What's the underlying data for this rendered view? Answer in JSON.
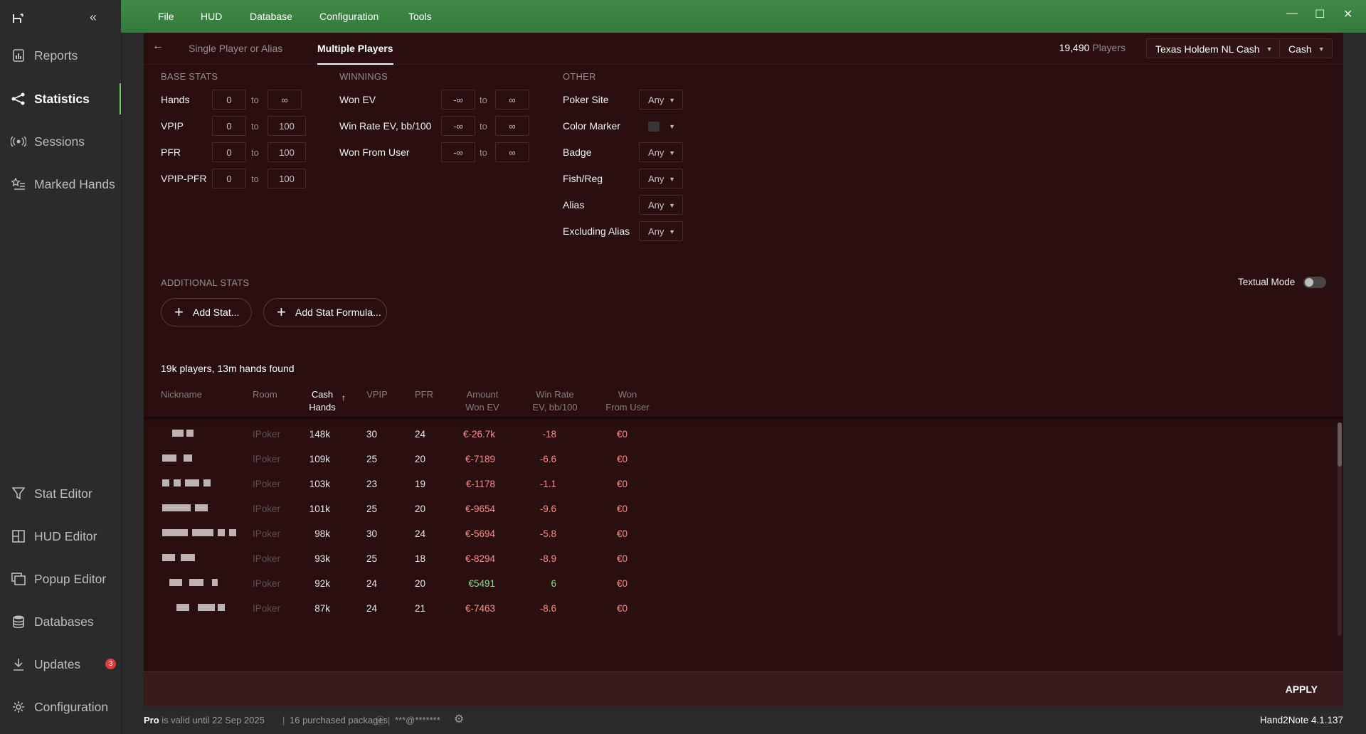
{
  "sidebar": {
    "items": [
      {
        "label": "Reports",
        "icon": "report-icon"
      },
      {
        "label": "Statistics",
        "icon": "share-graph-icon",
        "active": true
      },
      {
        "label": "Sessions",
        "icon": "broadcast-icon"
      },
      {
        "label": "Marked Hands",
        "icon": "starred-list-icon"
      },
      {
        "label": "Stat Editor",
        "icon": "filter-icon"
      },
      {
        "label": "HUD Editor",
        "icon": "hud-grid-icon"
      },
      {
        "label": "Popup Editor",
        "icon": "popup-icon"
      },
      {
        "label": "Databases",
        "icon": "database-icon"
      },
      {
        "label": "Updates",
        "icon": "download-icon",
        "badge": "3"
      },
      {
        "label": "Configuration",
        "icon": "gear-icon"
      }
    ]
  },
  "menu": [
    "File",
    "HUD",
    "Database",
    "Configuration",
    "Tools"
  ],
  "tabs": {
    "single": "Single Player or Alias",
    "multiple": "Multiple Players"
  },
  "header": {
    "players_count": "19,490",
    "players_label": "Players",
    "game": "Texas Holdem NL Cash",
    "mode": "Cash"
  },
  "base_stats": {
    "title": "BASE STATS",
    "rows": [
      {
        "label": "Hands",
        "from": "0",
        "to": "∞"
      },
      {
        "label": "VPIP",
        "from": "0",
        "to": "100"
      },
      {
        "label": "PFR",
        "from": "0",
        "to": "100"
      },
      {
        "label": "VPIP-PFR",
        "from": "0",
        "to": "100"
      }
    ],
    "to_word": "to"
  },
  "winnings": {
    "title": "WINNINGS",
    "rows": [
      {
        "label": "Won EV",
        "from": "-∞",
        "to": "∞"
      },
      {
        "label": "Win Rate EV, bb/100",
        "from": "-∞",
        "to": "∞"
      },
      {
        "label": "Won From User",
        "from": "-∞",
        "to": "∞"
      }
    ]
  },
  "other": {
    "title": "OTHER",
    "rows": [
      {
        "label": "Poker Site",
        "value": "Any"
      },
      {
        "label": "Color Marker",
        "value": ""
      },
      {
        "label": "Badge",
        "value": "Any"
      },
      {
        "label": "Fish/Reg",
        "value": "Any"
      },
      {
        "label": "Alias",
        "value": "Any"
      },
      {
        "label": "Excluding Alias",
        "value": "Any"
      }
    ]
  },
  "additional": {
    "title": "ADDITIONAL STATS",
    "add_stat": "Add Stat...",
    "add_formula": "Add Stat Formula...",
    "textual_mode": "Textual Mode"
  },
  "results": {
    "found": "19k players, 13m hands found"
  },
  "table": {
    "headers": {
      "nickname": "Nickname",
      "room": "Room",
      "cash_hands_1": "Cash",
      "cash_hands_2": "Hands",
      "sort_arrow": "↑",
      "vpip": "VPIP",
      "pfr": "PFR",
      "amount_1": "Amount",
      "amount_2": "Won EV",
      "winrate_1": "Win Rate",
      "winrate_2": "EV, bb/100",
      "won_1": "Won",
      "won_2": "From User"
    },
    "rows": [
      {
        "room": "IPoker",
        "hands": "148k",
        "vpip": "30",
        "pfr": "24",
        "amount": "€-26.7k",
        "winrate": "-18",
        "won": "€0"
      },
      {
        "room": "IPoker",
        "hands": "109k",
        "vpip": "25",
        "pfr": "20",
        "amount": "€-7189",
        "winrate": "-6.6",
        "won": "€0"
      },
      {
        "room": "IPoker",
        "hands": "103k",
        "vpip": "23",
        "pfr": "19",
        "amount": "€-1178",
        "winrate": "-1.1",
        "won": "€0"
      },
      {
        "room": "IPoker",
        "hands": "101k",
        "vpip": "25",
        "pfr": "20",
        "amount": "€-9654",
        "winrate": "-9.6",
        "won": "€0"
      },
      {
        "room": "IPoker",
        "hands": "98k",
        "vpip": "30",
        "pfr": "24",
        "amount": "€-5694",
        "winrate": "-5.8",
        "won": "€0"
      },
      {
        "room": "IPoker",
        "hands": "93k",
        "vpip": "25",
        "pfr": "18",
        "amount": "€-8294",
        "winrate": "-8.9",
        "won": "€0"
      },
      {
        "room": "IPoker",
        "hands": "92k",
        "vpip": "24",
        "pfr": "20",
        "amount": "€5491",
        "winrate": "6",
        "won": "€0"
      },
      {
        "room": "IPoker",
        "hands": "87k",
        "vpip": "24",
        "pfr": "21",
        "amount": "€-7463",
        "winrate": "-8.6",
        "won": "€0"
      }
    ]
  },
  "apply": "APPLY",
  "footer": {
    "pro": "Pro",
    "valid": "is valid until 22 Sep 2025",
    "packages": "16 purchased packages",
    "email": "***@*******",
    "version": "Hand2Note 4.1.137"
  },
  "colors": {
    "accent": "#7cc96a",
    "topbar": "#3f8a47",
    "panel": "#2a0f11",
    "negative": "#ff8c8c",
    "positive": "#8ee08e"
  }
}
